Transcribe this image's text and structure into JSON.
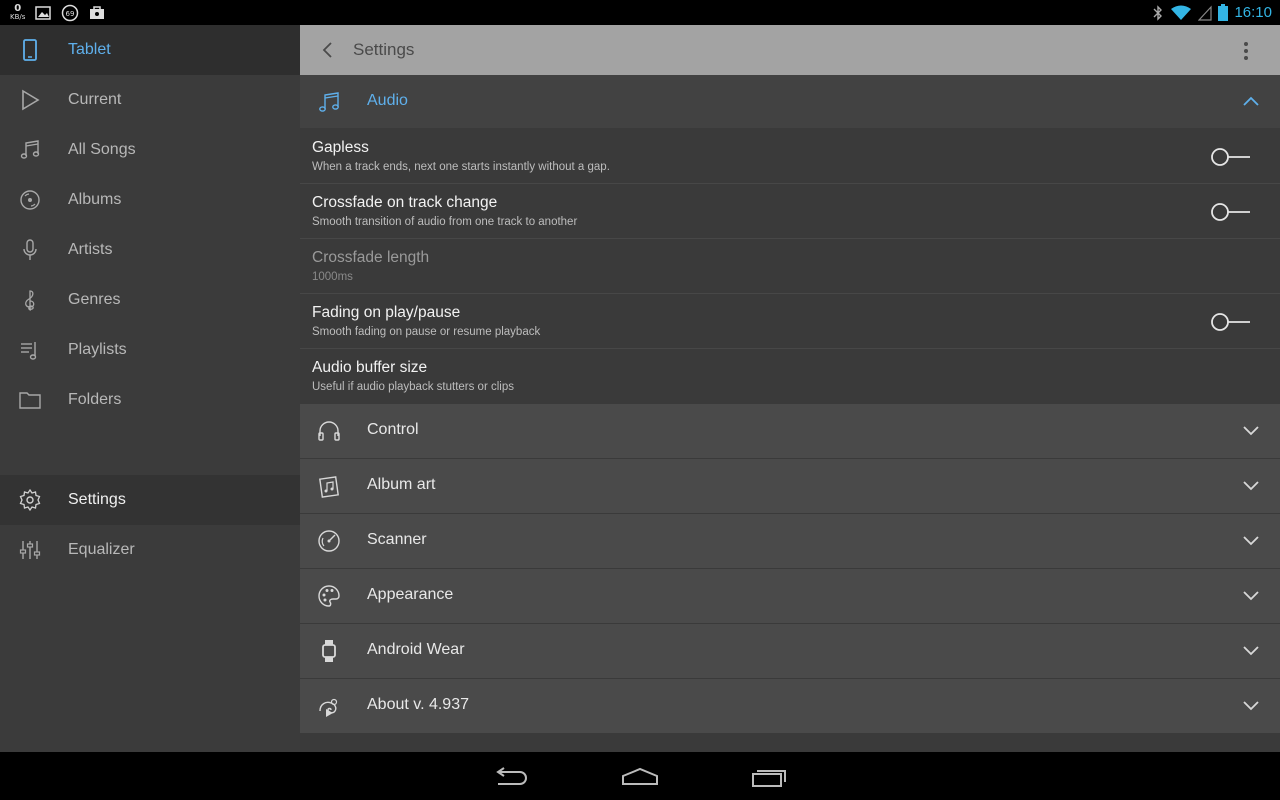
{
  "status_bar": {
    "net_speed_value": "0",
    "net_speed_unit": "KB/s",
    "notification_badge": "69",
    "time": "16:10"
  },
  "sidebar": {
    "header": {
      "label": "Tablet",
      "icon": "tablet-icon"
    },
    "items": [
      {
        "label": "Current",
        "icon": "play-icon"
      },
      {
        "label": "All Songs",
        "icon": "music-note-icon"
      },
      {
        "label": "Albums",
        "icon": "disc-icon"
      },
      {
        "label": "Artists",
        "icon": "microphone-icon"
      },
      {
        "label": "Genres",
        "icon": "treble-clef-icon"
      },
      {
        "label": "Playlists",
        "icon": "playlist-icon"
      },
      {
        "label": "Folders",
        "icon": "folder-icon"
      }
    ],
    "bottom_items": [
      {
        "label": "Settings",
        "icon": "gear-icon",
        "active": true
      },
      {
        "label": "Equalizer",
        "icon": "equalizer-icon"
      }
    ]
  },
  "appbar": {
    "title": "Settings"
  },
  "audio_section": {
    "label": "Audio",
    "accent": "#5fb0ec",
    "prefs": [
      {
        "title": "Gapless",
        "summary": "When a track ends, next one starts instantly without a gap.",
        "toggle": "off"
      },
      {
        "title": "Crossfade on track change",
        "summary": "Smooth transition of audio from one track to another",
        "toggle": "off"
      },
      {
        "title": "Crossfade length",
        "summary": "1000ms",
        "disabled": true
      },
      {
        "title": "Fading on play/pause",
        "summary": "Smooth fading on pause or resume playback",
        "toggle": "off"
      },
      {
        "title": "Audio buffer size",
        "summary": "Useful if audio playback stutters or clips"
      }
    ]
  },
  "sections": [
    {
      "label": "Control",
      "icon": "headphones-icon"
    },
    {
      "label": "Album art",
      "icon": "album-art-icon"
    },
    {
      "label": "Scanner",
      "icon": "scanner-icon"
    },
    {
      "label": "Appearance",
      "icon": "palette-icon"
    },
    {
      "label": "Android Wear",
      "icon": "watch-icon"
    },
    {
      "label": "About v. 4.937",
      "icon": "chameleon-icon"
    }
  ]
}
